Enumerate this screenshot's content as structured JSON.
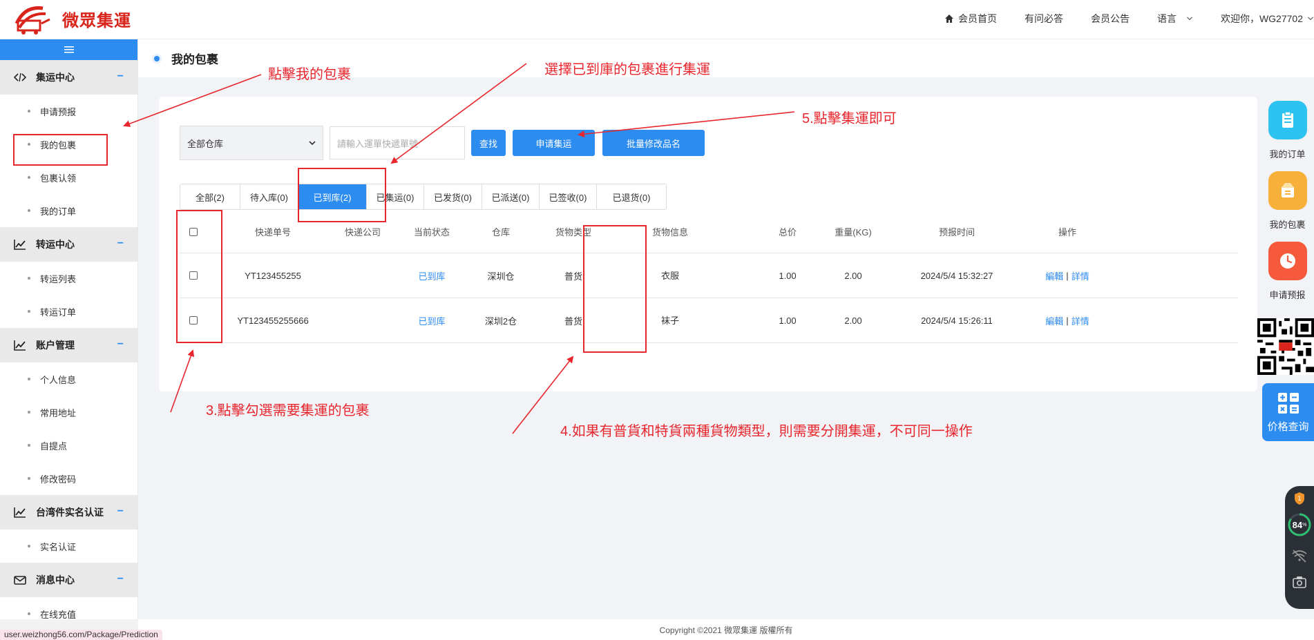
{
  "brand": {
    "name": "微眾集運"
  },
  "topnav": {
    "home": "会员首页",
    "faq": "有问必答",
    "notice": "会员公告",
    "language": "语言",
    "welcome": "欢迎你，WG27702"
  },
  "sidebar": {
    "groups": [
      {
        "label": "集运中心",
        "icon": "code-icon",
        "items": [
          "申请预报",
          "我的包裹",
          "包裹认领",
          "我的订单"
        ]
      },
      {
        "label": "转运中心",
        "icon": "trend-chart-icon",
        "items": [
          "转运列表",
          "转运订单"
        ]
      },
      {
        "label": "账户管理",
        "icon": "trend-chart-icon",
        "items": [
          "个人信息",
          "常用地址",
          "自提点",
          "修改密码"
        ]
      },
      {
        "label": "台湾件实名认证",
        "icon": "trend-chart-icon",
        "items": [
          "实名认证"
        ]
      },
      {
        "label": "消息中心",
        "icon": "mail-icon",
        "items": [
          "在线充值"
        ]
      }
    ]
  },
  "page": {
    "title": "我的包裹"
  },
  "filters": {
    "warehouse_selected": "全部仓库",
    "search_placeholder": "請輸入運單快遞單號",
    "find_label": "查找",
    "apply_label": "申请集运",
    "rename_label": "批量修改品名"
  },
  "tabs": [
    {
      "label": "全部(2)",
      "active": false
    },
    {
      "label": "待入库(0)",
      "active": false
    },
    {
      "label": "已到库(2)",
      "active": true
    },
    {
      "label": "已集运(0)",
      "active": false
    },
    {
      "label": "已发货(0)",
      "active": false
    },
    {
      "label": "已派送(0)",
      "active": false
    },
    {
      "label": "已签收(0)",
      "active": false
    },
    {
      "label": "已退货(0)",
      "active": false
    }
  ],
  "table": {
    "columns": [
      "快递单号",
      "快递公司",
      "当前状态",
      "仓库",
      "货物类型",
      "货物信息",
      "总价",
      "重量(KG)",
      "预报时间",
      "操作"
    ],
    "rows": [
      {
        "tracking": "YT123455255",
        "company": "",
        "status": "已到库",
        "warehouse": "深圳仓",
        "type": "普货",
        "info": "衣服",
        "price": "1.00",
        "weight": "2.00",
        "time": "2024/5/4 15:32:27",
        "edit": "編輯",
        "detail": "詳情"
      },
      {
        "tracking": "YT123455255666",
        "company": "",
        "status": "已到库",
        "warehouse": "深圳2仓",
        "type": "普货",
        "info": "袜子",
        "price": "1.00",
        "weight": "2.00",
        "time": "2024/5/4 15:26:11",
        "edit": "編輯",
        "detail": "詳情"
      }
    ]
  },
  "float_bar": {
    "items": [
      {
        "label": "我的订单",
        "icon": "clipboard-icon",
        "color": "#2ec2f0"
      },
      {
        "label": "我的包裹",
        "icon": "package-icon",
        "color": "#f7b13a"
      },
      {
        "label": "申请预报",
        "icon": "clock-icon",
        "color": "#f55a3c"
      }
    ],
    "price_label": "价格查询"
  },
  "perf_widget": {
    "badge": "1",
    "score": "84",
    "unit": "%"
  },
  "footer": {
    "copyright": "Copyright ©2021 微眾集運 版權所有"
  },
  "status_url": "user.weizhong56.com/Package/Prediction",
  "annotations": {
    "click_my_package": "點擊我的包裹",
    "choose_arrived": "選擇已到庫的包裹進行集運",
    "click_consolidate": "5.點擊集運即可",
    "check_packages": "3.點擊勾選需要集運的包裹",
    "separate_types": "4.如果有普貨和特貨兩種貨物類型，則需要分開集運，不可同一操作"
  },
  "colors": {
    "accent": "#2d8cf0",
    "brand": "#d9241b",
    "annotation": "#e8262d"
  }
}
